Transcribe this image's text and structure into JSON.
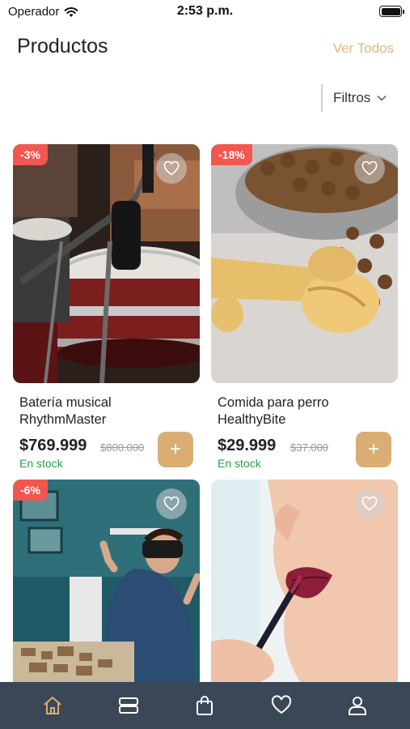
{
  "status_bar": {
    "carrier": "Operador",
    "time": "2:53 p.m."
  },
  "header": {
    "title": "Productos",
    "see_all": "Ver Todos"
  },
  "filters": {
    "label": "Filtros"
  },
  "colors": {
    "accent": "#d9ad74",
    "link": "#e0b77f",
    "badge": "#f2574f",
    "in_stock": "#25a244",
    "tab_bar": "#3a4756"
  },
  "products": [
    {
      "discount": "-3%",
      "name": "Batería musical RhythmMaster",
      "price": "$769.999",
      "old_price": "$800.000",
      "stock": "En stock",
      "image": "drum-kit-photo"
    },
    {
      "discount": "-18%",
      "name": "Comida para perro HealthyBite",
      "price": "$29.999",
      "old_price": "$37.000",
      "stock": "En stock",
      "image": "dog-food-photo"
    },
    {
      "discount": "-6%",
      "image": "vr-headset-photo"
    },
    {
      "image": "lipstick-photo"
    }
  ],
  "add_label": "+",
  "tab_bar": {
    "items": [
      "home-icon",
      "catalog-icon",
      "bag-icon",
      "heart-icon",
      "user-icon"
    ]
  }
}
